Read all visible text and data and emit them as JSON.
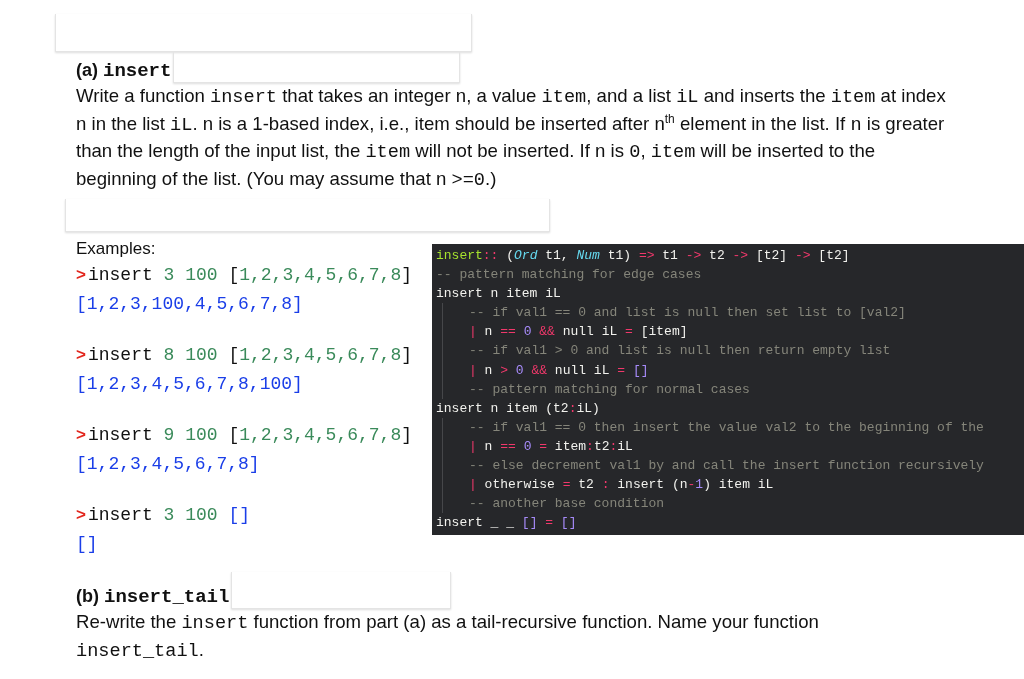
{
  "part_a": {
    "label": "(a)",
    "name": "insert",
    "description": [
      {
        "kind": "text",
        "text": "Write a function "
      },
      {
        "kind": "code",
        "text": "insert"
      },
      {
        "kind": "text",
        "text": " that takes an integer n, a value "
      },
      {
        "kind": "code",
        "text": "item"
      },
      {
        "kind": "text",
        "text": ", and a list "
      },
      {
        "kind": "code",
        "text": "iL"
      },
      {
        "kind": "text",
        "text": " and inserts the "
      },
      {
        "kind": "code",
        "text": "item"
      },
      {
        "kind": "text",
        "text": " at index n in the list "
      },
      {
        "kind": "code",
        "text": "iL"
      },
      {
        "kind": "text",
        "text": ". n is a 1-based index, i.e., item should be inserted after n"
      },
      {
        "kind": "sup",
        "text": "th"
      },
      {
        "kind": "text",
        "text": " element in the list. If "
      },
      {
        "kind": "code",
        "text": "n"
      },
      {
        "kind": "text",
        "text": " is greater than the length of the input list, the "
      },
      {
        "kind": "code",
        "text": "item"
      },
      {
        "kind": "text",
        "text": " will not be inserted. If n is "
      },
      {
        "kind": "code",
        "text": "0"
      },
      {
        "kind": "text",
        "text": ", "
      },
      {
        "kind": "code",
        "text": "item"
      },
      {
        "kind": "text",
        "text": " will be inserted to the beginning of the list. (You may assume that n "
      },
      {
        "kind": "code",
        "text": ">=0"
      },
      {
        "kind": "text",
        "text": ".)"
      }
    ]
  },
  "examples": {
    "title": "Examples:",
    "items": [
      {
        "prompt": ">",
        "call": [
          {
            "kind": "plain",
            "text": "insert "
          },
          {
            "kind": "number",
            "text": "3 100 "
          },
          {
            "kind": "plain",
            "text": "["
          },
          {
            "kind": "number",
            "text": "1,2,3,4,5,6,7,8"
          },
          {
            "kind": "plain",
            "text": "]"
          }
        ],
        "result": "[1,2,3,100,4,5,6,7,8]"
      },
      {
        "prompt": ">",
        "call": [
          {
            "kind": "plain",
            "text": "insert "
          },
          {
            "kind": "number",
            "text": "8 100 "
          },
          {
            "kind": "plain",
            "text": "["
          },
          {
            "kind": "number",
            "text": "1,2,3,4,5,6,7,8"
          },
          {
            "kind": "plain",
            "text": "]"
          }
        ],
        "result": "[1,2,3,4,5,6,7,8,100]"
      },
      {
        "prompt": ">",
        "call": [
          {
            "kind": "plain",
            "text": "insert "
          },
          {
            "kind": "number",
            "text": "9 100 "
          },
          {
            "kind": "plain",
            "text": "["
          },
          {
            "kind": "number",
            "text": "1,2,3,4,5,6,7,8"
          },
          {
            "kind": "plain",
            "text": "]"
          }
        ],
        "result": "[1,2,3,4,5,6,7,8]"
      },
      {
        "prompt": ">",
        "call": [
          {
            "kind": "plain",
            "text": "insert "
          },
          {
            "kind": "number",
            "text": "3 100 "
          },
          {
            "kind": "result",
            "text": "[]"
          }
        ],
        "result": "[]"
      }
    ]
  },
  "code": [
    {
      "indented": false,
      "tokens": [
        {
          "kind": "fn",
          "text": "insert"
        },
        {
          "kind": "op",
          "text": "::"
        },
        {
          "kind": "plain",
          "text": " ("
        },
        {
          "kind": "type",
          "text": "Ord"
        },
        {
          "kind": "plain",
          "text": " t1, "
        },
        {
          "kind": "type",
          "text": "Num"
        },
        {
          "kind": "plain",
          "text": " t1) "
        },
        {
          "kind": "op",
          "text": "=>"
        },
        {
          "kind": "plain",
          "text": " t1 "
        },
        {
          "kind": "op",
          "text": "->"
        },
        {
          "kind": "plain",
          "text": " t2 "
        },
        {
          "kind": "op",
          "text": "->"
        },
        {
          "kind": "plain",
          "text": " [t2] "
        },
        {
          "kind": "op",
          "text": "->"
        },
        {
          "kind": "plain",
          "text": " [t2]"
        }
      ]
    },
    {
      "indented": false,
      "tokens": [
        {
          "kind": "comment",
          "text": "-- pattern matching for edge cases"
        }
      ]
    },
    {
      "indented": false,
      "tokens": [
        {
          "kind": "plain",
          "text": "insert n item iL"
        }
      ]
    },
    {
      "indented": true,
      "tokens": [
        {
          "kind": "comment",
          "text": "-- if val1 == 0 and list is null then set list to [val2]"
        }
      ]
    },
    {
      "indented": true,
      "tokens": [
        {
          "kind": "op",
          "text": "|"
        },
        {
          "kind": "plain",
          "text": " n "
        },
        {
          "kind": "op",
          "text": "== "
        },
        {
          "kind": "number",
          "text": "0"
        },
        {
          "kind": "op",
          "text": " && "
        },
        {
          "kind": "plain",
          "text": "null iL "
        },
        {
          "kind": "op",
          "text": "="
        },
        {
          "kind": "plain",
          "text": " [item]"
        }
      ]
    },
    {
      "indented": true,
      "tokens": [
        {
          "kind": "comment",
          "text": "-- if val1 > 0 and list is null then return empty list"
        }
      ]
    },
    {
      "indented": true,
      "tokens": [
        {
          "kind": "op",
          "text": "|"
        },
        {
          "kind": "plain",
          "text": " n "
        },
        {
          "kind": "op",
          "text": "> "
        },
        {
          "kind": "number",
          "text": "0"
        },
        {
          "kind": "op",
          "text": " && "
        },
        {
          "kind": "plain",
          "text": "null iL "
        },
        {
          "kind": "op",
          "text": "= "
        },
        {
          "kind": "number",
          "text": "[]"
        }
      ]
    },
    {
      "indented": true,
      "tokens": [
        {
          "kind": "comment",
          "text": "-- pattern matching for normal cases"
        }
      ]
    },
    {
      "indented": false,
      "tokens": [
        {
          "kind": "plain",
          "text": "insert n item (t2"
        },
        {
          "kind": "op",
          "text": ":"
        },
        {
          "kind": "plain",
          "text": "iL)"
        }
      ]
    },
    {
      "indented": true,
      "tokens": [
        {
          "kind": "comment",
          "text": "-- if val1 == 0 then insert the value val2 to the beginning of the"
        }
      ]
    },
    {
      "indented": true,
      "tokens": [
        {
          "kind": "op",
          "text": "|"
        },
        {
          "kind": "plain",
          "text": " n "
        },
        {
          "kind": "op",
          "text": "== "
        },
        {
          "kind": "number",
          "text": "0"
        },
        {
          "kind": "op",
          "text": " = "
        },
        {
          "kind": "plain",
          "text": "item"
        },
        {
          "kind": "op",
          "text": ":"
        },
        {
          "kind": "plain",
          "text": "t2"
        },
        {
          "kind": "op",
          "text": ":"
        },
        {
          "kind": "plain",
          "text": "iL"
        }
      ]
    },
    {
      "indented": true,
      "tokens": [
        {
          "kind": "comment",
          "text": "-- else decrement val1 by and call the insert function recursively"
        }
      ]
    },
    {
      "indented": true,
      "tokens": [
        {
          "kind": "op",
          "text": "|"
        },
        {
          "kind": "plain",
          "text": " otherwise "
        },
        {
          "kind": "op",
          "text": "="
        },
        {
          "kind": "plain",
          "text": " t2 "
        },
        {
          "kind": "op",
          "text": ":"
        },
        {
          "kind": "plain",
          "text": " insert (n"
        },
        {
          "kind": "op",
          "text": "-"
        },
        {
          "kind": "number",
          "text": "1"
        },
        {
          "kind": "plain",
          "text": ") item iL"
        }
      ]
    },
    {
      "indented": true,
      "tokens": [
        {
          "kind": "comment",
          "text": "-- another base condition"
        }
      ]
    },
    {
      "indented": false,
      "tokens": [
        {
          "kind": "plain",
          "text": "insert _ _ "
        },
        {
          "kind": "number",
          "text": "[]"
        },
        {
          "kind": "op",
          "text": " = "
        },
        {
          "kind": "number",
          "text": "[]"
        }
      ]
    }
  ],
  "part_b": {
    "label": "(b)",
    "name": "insert_tail",
    "description": [
      {
        "kind": "text",
        "text": "Re-write the "
      },
      {
        "kind": "code",
        "text": "insert"
      },
      {
        "kind": "text",
        "text": " function from part (a) as a tail-recursive function.  Name your function "
      },
      {
        "kind": "code",
        "text": "insert_tail"
      },
      {
        "kind": "text",
        "text": "."
      }
    ]
  }
}
